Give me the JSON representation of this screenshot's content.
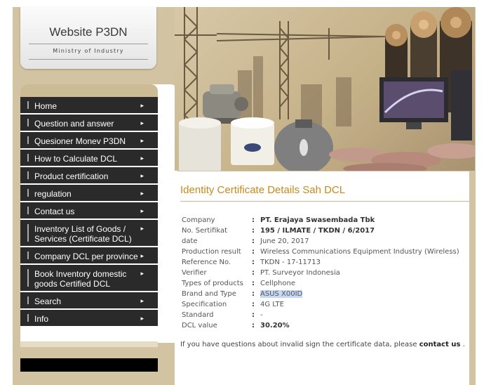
{
  "site": {
    "title": "Website P3DN",
    "subtitle": "Ministry of Industry"
  },
  "nav": {
    "items": [
      {
        "label": "Home"
      },
      {
        "label": "Question and answer"
      },
      {
        "label": "Quesioner Monev P3DN"
      },
      {
        "label": "How to Calculate DCL"
      },
      {
        "label": "Product certification"
      },
      {
        "label": "regulation"
      },
      {
        "label": "Contact us"
      },
      {
        "label": "Inventory List of Goods / Services (Certificate DCL)"
      },
      {
        "label": "Company DCL per province"
      },
      {
        "label": "Book Inventory domestic goods Certified DCL"
      },
      {
        "label": "Search"
      },
      {
        "label": "Info"
      }
    ],
    "arrow": "▸"
  },
  "page": {
    "heading": "Identity Certificate Details Sah DCL",
    "separator": ":",
    "details": [
      {
        "key": "Company",
        "value": "PT. Erajaya Swasembada Tbk",
        "bold": true
      },
      {
        "key": "No. Sertifikat",
        "value": "195 / ILMATE / TKDN / 6/2017",
        "bold": true
      },
      {
        "key": "date",
        "value": "June 20, 2017"
      },
      {
        "key": "Production result",
        "value": "Wireless Communications Equipment Industry (Wireless)"
      },
      {
        "key": "Reference No.",
        "value": "TKDN - 17-11713"
      },
      {
        "key": "Verifier",
        "value": "PT. Surveyor Indonesia"
      },
      {
        "key": "Types of products",
        "value": "Cellphone"
      },
      {
        "key": "Brand and Type",
        "value": "ASUS X00ID",
        "highlight": true
      },
      {
        "key": "Specification",
        "value": "4G LTE"
      },
      {
        "key": "Standard",
        "value": "-"
      },
      {
        "key": "DCL value",
        "value": "30.20%",
        "bold": true
      }
    ],
    "note_text": "If you have questions about invalid sign the certificate data, please",
    "note_link": "contact us",
    "note_end": "."
  },
  "colors": {
    "accent": "#c98a1a",
    "frame": "#d2c3a2",
    "nav_bg": "#2a2a2a"
  }
}
